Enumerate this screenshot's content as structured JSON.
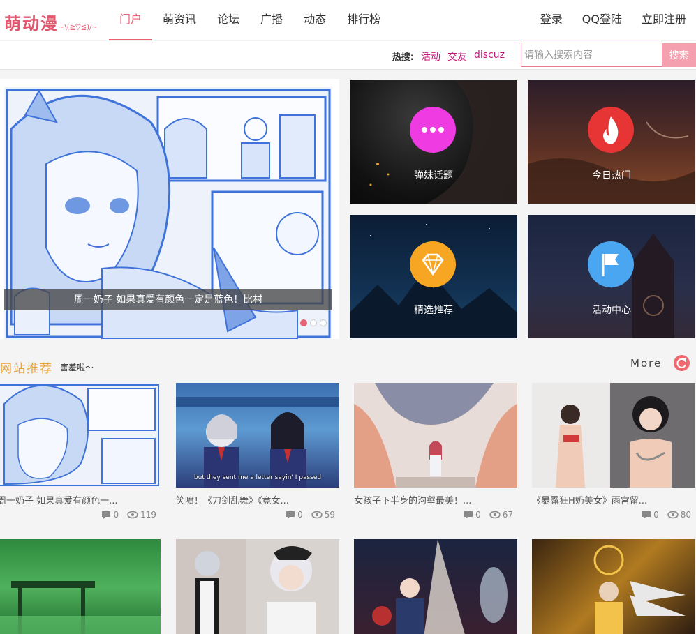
{
  "brand": {
    "name": "萌动漫",
    "emote": "~\\(≧▽≦)/~"
  },
  "nav": {
    "items": [
      "门户",
      "萌资讯",
      "论坛",
      "广播",
      "动态",
      "排行榜"
    ],
    "active": "门户"
  },
  "user_links": [
    "登录",
    "QQ登陆",
    "立即注册"
  ],
  "search": {
    "hot_label": "热搜:",
    "hot_terms": [
      "活动",
      "交友",
      "discuz"
    ],
    "placeholder": "请输入搜索内容",
    "button": "搜索"
  },
  "hero": {
    "caption": "周一奶子 如果真爱有颜色一定是蓝色！比村"
  },
  "tiles": [
    {
      "label": "弹妹话题",
      "icon": "chat-bubble-icon",
      "color": "#ee3be2"
    },
    {
      "label": "今日热门",
      "icon": "flame-icon",
      "color": "#e73535"
    },
    {
      "label": "精选推荐",
      "icon": "diamond-icon",
      "color": "#f6a623"
    },
    {
      "label": "活动中心",
      "icon": "flag-icon",
      "color": "#4aa6f0"
    }
  ],
  "section": {
    "title": "网站推荐",
    "subtitle": "害羞啦～",
    "more": "More"
  },
  "cards": [
    {
      "title": "周一奶子 如果真爱有颜色一...",
      "comments": "0",
      "views": "119"
    },
    {
      "title": "笑喷！《刀剑乱舞》《竟女...",
      "comments": "0",
      "views": "59",
      "subtitle": "but they sent me a letter sayin' I passed"
    },
    {
      "title": "女孩子下半身的沟壑最美！...",
      "comments": "0",
      "views": "67"
    },
    {
      "title": "《暴露狂H奶美女》雨宫留...",
      "comments": "0",
      "views": "80"
    }
  ],
  "colors": {
    "accent": "#e96276",
    "hot": "#c1157b",
    "section": "#e8a33a"
  }
}
